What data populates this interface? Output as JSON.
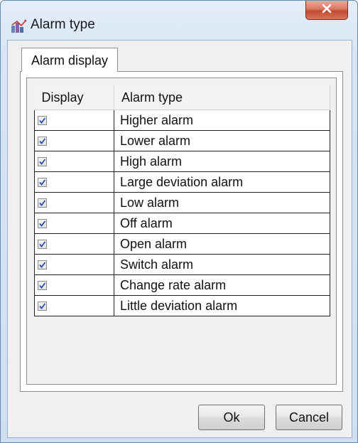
{
  "window": {
    "title": "Alarm type",
    "icon": "alarm-app-icon",
    "close_icon": "close-x-icon"
  },
  "tabs": [
    {
      "label": "Alarm display",
      "selected": true
    }
  ],
  "grid": {
    "columns": [
      "Display",
      "Alarm type"
    ],
    "rows": [
      {
        "checked": true,
        "type": "Higher alarm"
      },
      {
        "checked": true,
        "type": "Lower alarm"
      },
      {
        "checked": true,
        "type": "High alarm"
      },
      {
        "checked": true,
        "type": "Large deviation alarm"
      },
      {
        "checked": true,
        "type": "Low alarm"
      },
      {
        "checked": true,
        "type": "Off alarm"
      },
      {
        "checked": true,
        "type": "Open alarm"
      },
      {
        "checked": true,
        "type": "Switch alarm"
      },
      {
        "checked": true,
        "type": "Change rate alarm"
      },
      {
        "checked": true,
        "type": "Little deviation alarm"
      }
    ]
  },
  "buttons": {
    "ok": "Ok",
    "cancel": "Cancel"
  },
  "colors": {
    "close_button": "#c24a2e",
    "check_mark": "#2b4fa8"
  }
}
